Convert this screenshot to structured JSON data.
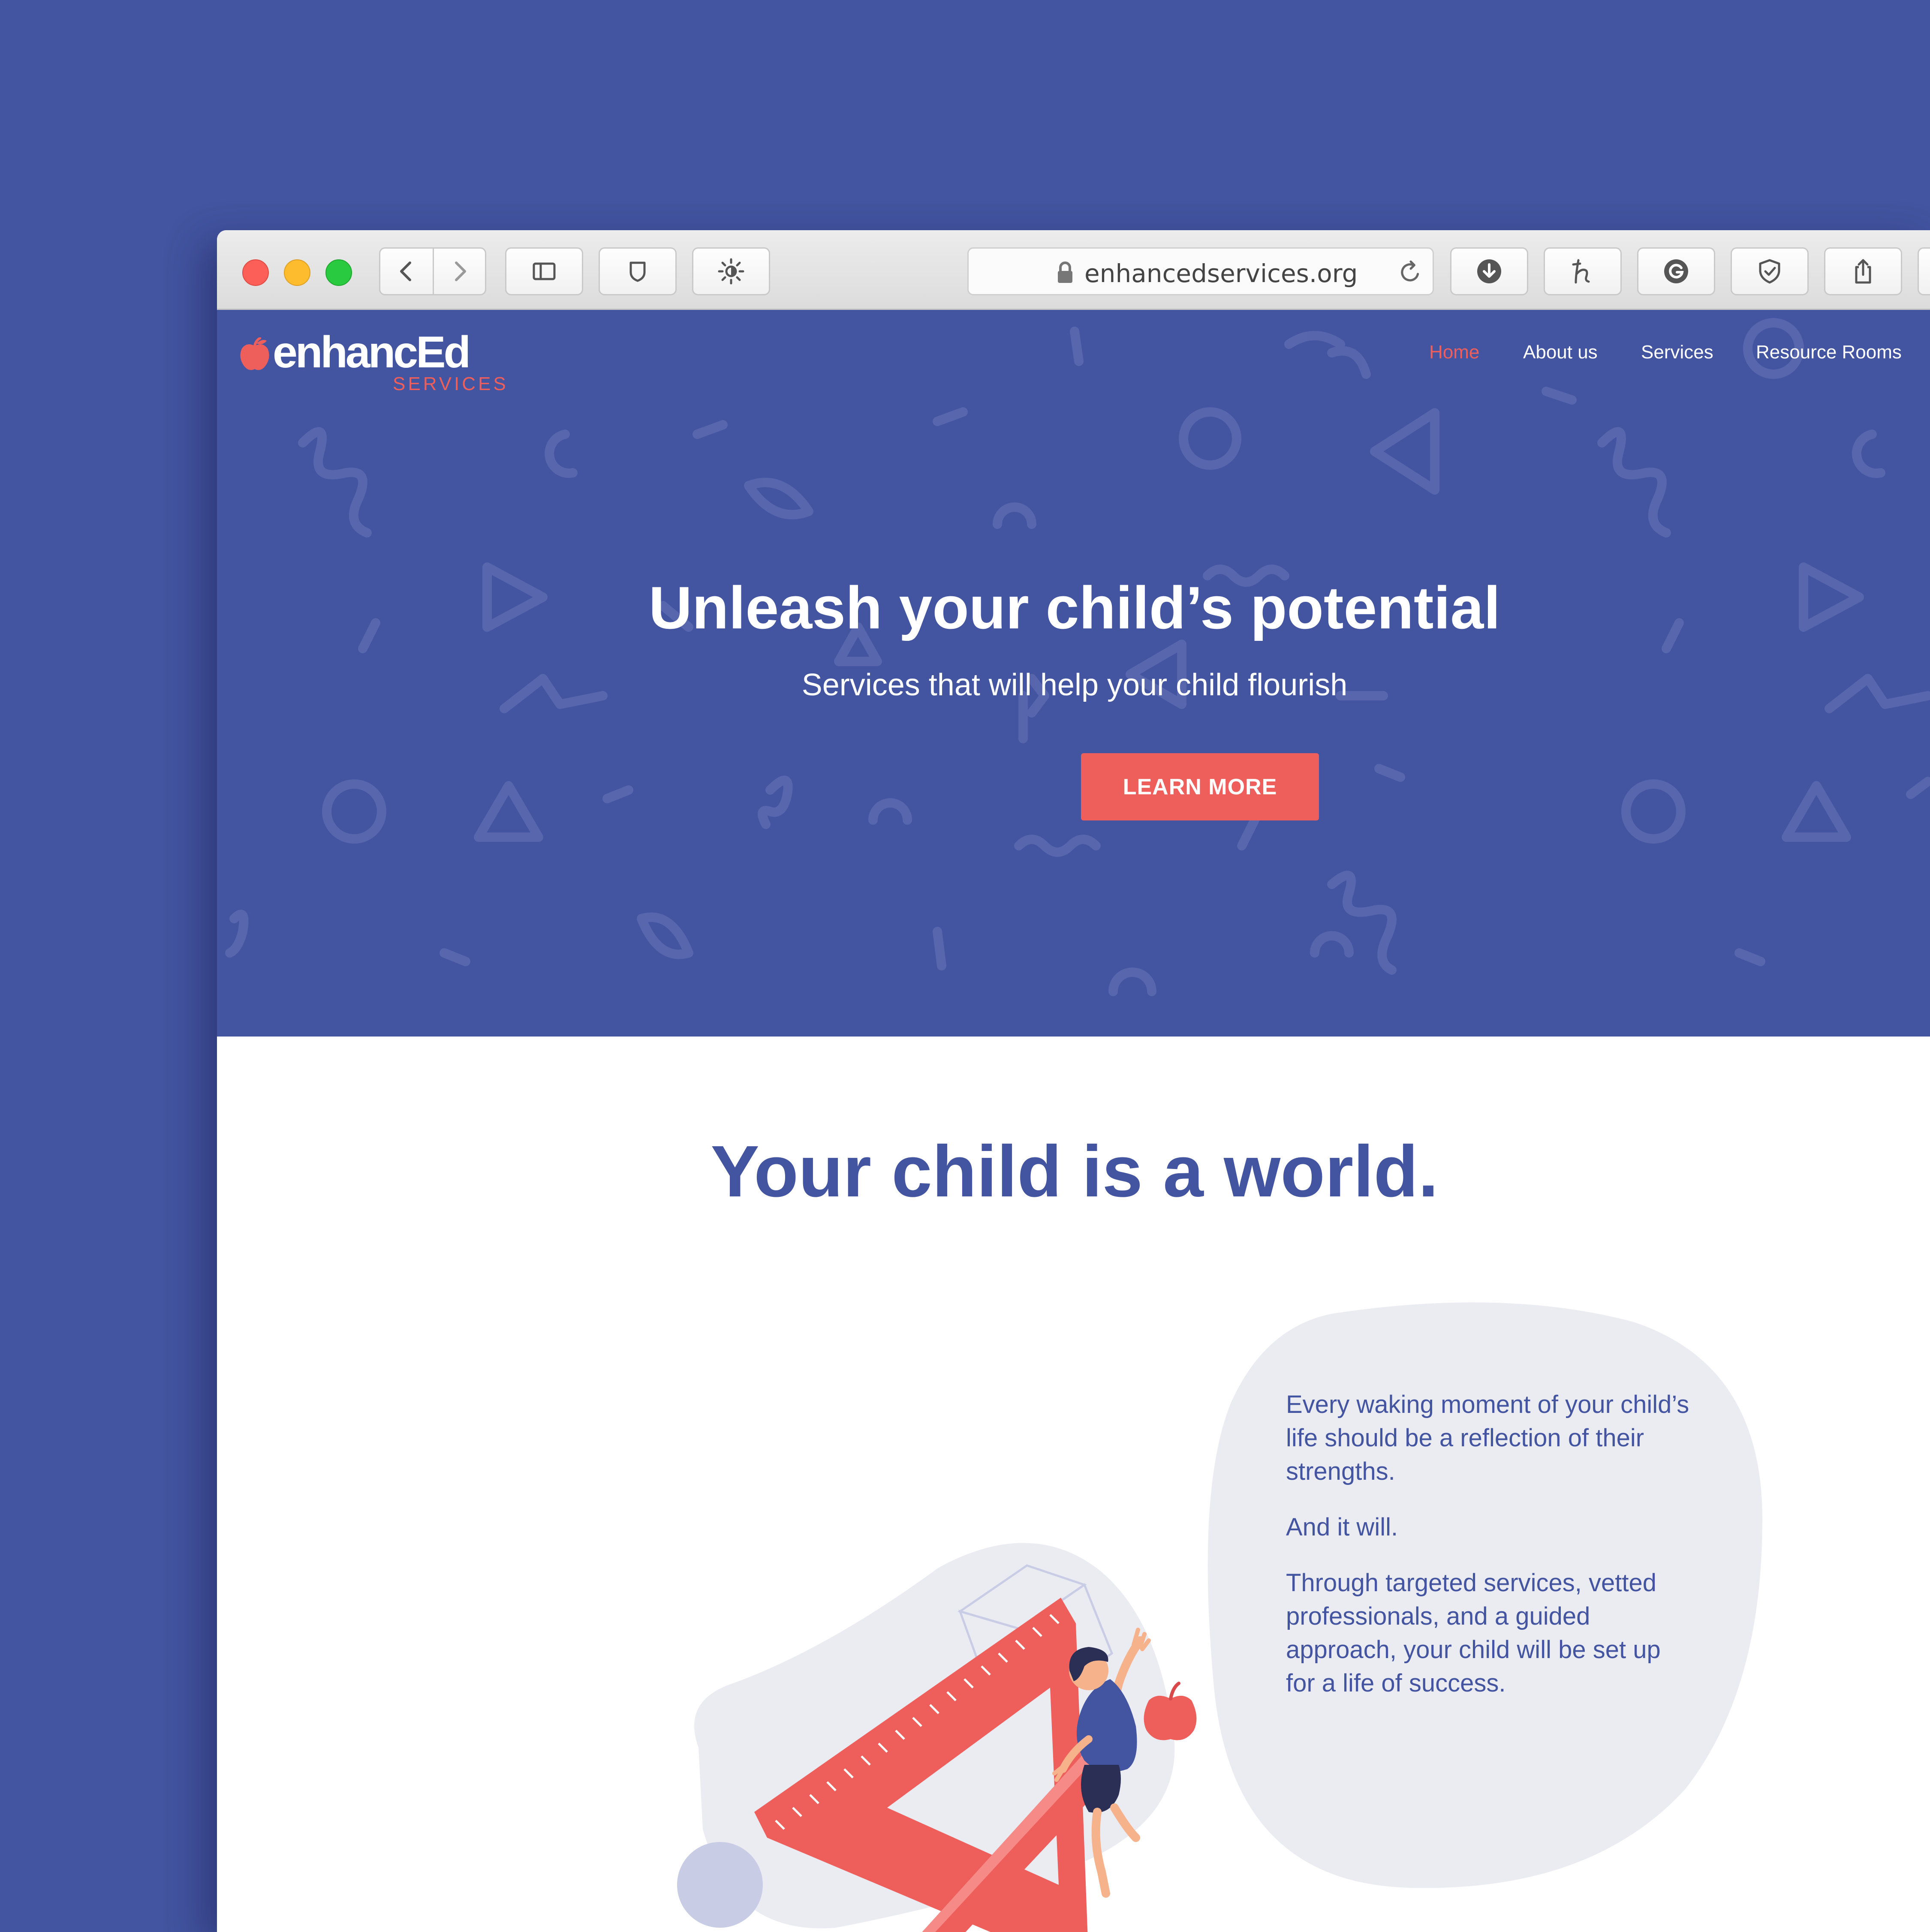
{
  "browser": {
    "url": "enhancedservices.org",
    "toolbar_icons": [
      "back-icon",
      "forward-icon",
      "sidebar-icon",
      "shield-icon",
      "brightness-icon",
      "reload-icon",
      "download-icon",
      "honey-icon",
      "grammarly-icon",
      "privacy-shield-icon",
      "share-icon"
    ]
  },
  "brand": {
    "word": "enhancEd",
    "sub": "SERVICES",
    "accent": "#ee5f5c",
    "primary": "#4354a0"
  },
  "nav": {
    "items": [
      "Home",
      "About us",
      "Services",
      "Resource Rooms"
    ],
    "active": "Home"
  },
  "hero": {
    "title": "Unleash your child’s potential",
    "subtitle": "Services that will help your child flourish",
    "cta": "LEARN MORE"
  },
  "section": {
    "title": "Your child is a world.",
    "paragraphs": [
      "Every waking moment of your child’s life should be a reflection of their strengths.",
      "And it will.",
      "Through targeted services, vetted professionals, and a guided approach, your child will be set up for a life of success."
    ]
  }
}
